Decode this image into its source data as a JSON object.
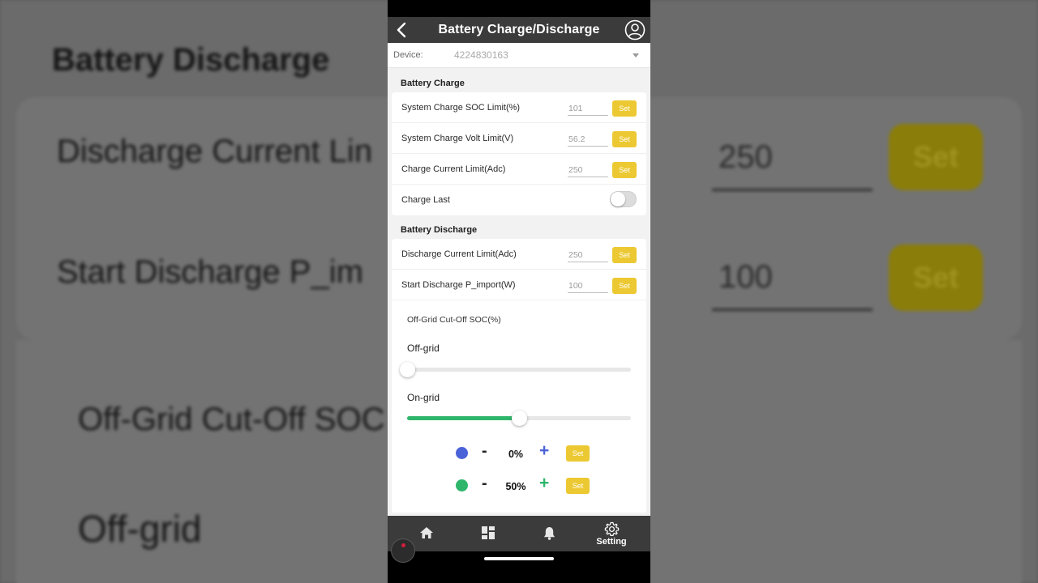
{
  "app": {
    "title": "Battery Charge/Discharge"
  },
  "device": {
    "label": "Device:",
    "value": "4224830163"
  },
  "battery_charge": {
    "heading": "Battery Charge",
    "rows": [
      {
        "label": "System Charge SOC Limit(%)",
        "value": "101",
        "button": "Set"
      },
      {
        "label": "System Charge Volt Limit(V)",
        "value": "56.2",
        "button": "Set"
      },
      {
        "label": "Charge Current Limit(Adc)",
        "value": "250",
        "button": "Set"
      }
    ],
    "charge_last": {
      "label": "Charge Last",
      "on": false
    }
  },
  "battery_discharge": {
    "heading": "Battery Discharge",
    "rows": [
      {
        "label": "Discharge Current Limit(Adc)",
        "value": "250",
        "button": "Set"
      },
      {
        "label": "Start Discharge P_import(W)",
        "value": "100",
        "button": "Set"
      }
    ]
  },
  "off_grid_cutoff": {
    "label": "Off-Grid Cut-Off SOC(%)",
    "off_grid": {
      "label": "Off-grid",
      "value_percent": 0
    },
    "on_grid": {
      "label": "On-grid",
      "value_percent": 50
    },
    "controls": [
      {
        "color": "#4b63d8",
        "minus": "-",
        "value": "0%",
        "plus": "+",
        "plus_color": "#4b63d8",
        "button": "Set"
      },
      {
        "color": "#2fb66b",
        "minus": "-",
        "value": "50%",
        "plus": "+",
        "plus_color": "#2fb66b",
        "button": "Set"
      }
    ]
  },
  "tabbar": {
    "items": [
      {
        "icon": "home-icon",
        "label": ""
      },
      {
        "icon": "dashboard-icon",
        "label": ""
      },
      {
        "icon": "bell-icon",
        "label": ""
      },
      {
        "icon": "gear-icon",
        "label": "Setting"
      }
    ]
  },
  "background": {
    "heading": "Battery Discharge",
    "row1_label": "Discharge Current Lin",
    "row1_value": "250",
    "row2_label": "Start Discharge P_im",
    "row2_value": "100",
    "button": "Set",
    "cutoff_label": "Off-Grid Cut-Off SOC",
    "offgrid_label": "Off-grid"
  },
  "colors": {
    "accent_yellow": "#ecc933",
    "on_grid_green": "#2fb66b",
    "off_grid_blue": "#4b63d8",
    "appbar": "#3b3b3b"
  }
}
